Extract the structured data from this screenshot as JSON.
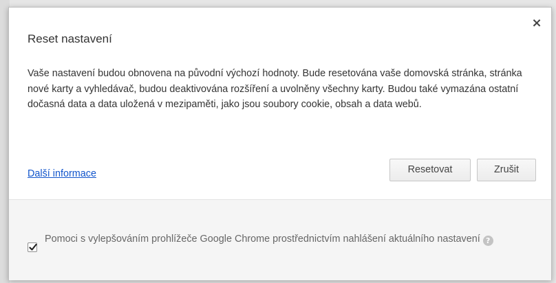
{
  "dialog": {
    "title": "Reset nastavení",
    "close_glyph": "×",
    "body": "Vaše nastavení budou obnovena na původní výchozí hodnoty. Bude resetována vaše domovská stránka, stránka nové karty a vyhledávač, budou deaktivována rozšíření a uvolněny všechny karty. Budou také vymazána ostatní dočasná data a data uložená v mezipaměti, jako jsou soubory cookie, obsah a data webů.",
    "more_info_link": "Další informace",
    "reset_button": "Resetovat",
    "cancel_button": "Zrušit",
    "feedback_checkbox": {
      "checked": true,
      "label": "Pomoci s vylepšováním prohlížeče Google Chrome prostřednictvím nahlášení aktuálního nastavení",
      "help_glyph": "?"
    }
  },
  "colors": {
    "link": "#1155cc",
    "footer_bg": "#f5f5f5",
    "text": "#333333"
  },
  "icons": {
    "close": "close-icon",
    "check": "checkmark-icon",
    "help": "help-icon"
  }
}
